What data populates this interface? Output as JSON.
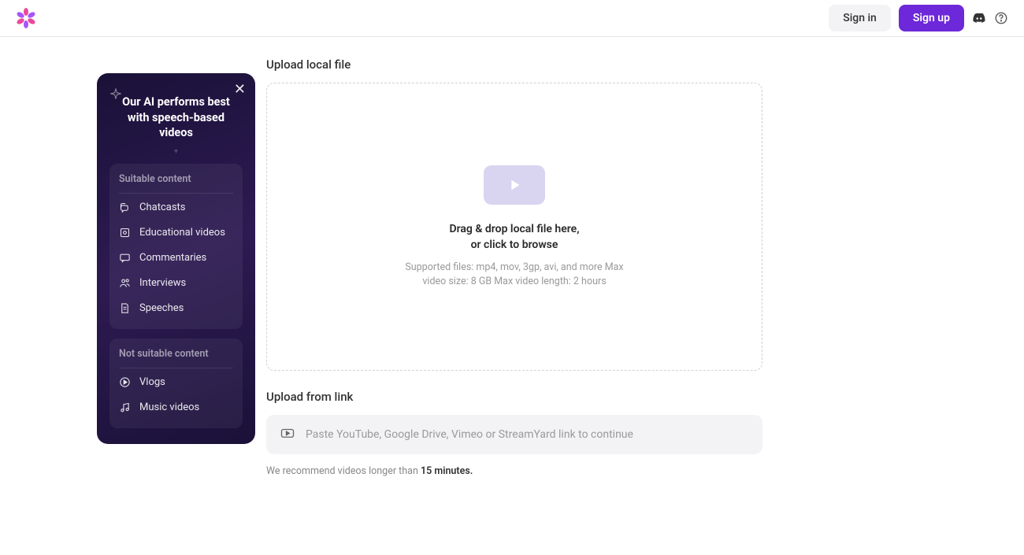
{
  "header": {
    "signin_label": "Sign in",
    "signup_label": "Sign up"
  },
  "info_card": {
    "title": "Our AI performs best with speech-based videos",
    "suitable": {
      "title": "Suitable content",
      "items": [
        {
          "label": "Chatcasts",
          "icon": "chat"
        },
        {
          "label": "Educational videos",
          "icon": "book"
        },
        {
          "label": "Commentaries",
          "icon": "comment"
        },
        {
          "label": "Interviews",
          "icon": "people"
        },
        {
          "label": "Speeches",
          "icon": "doc"
        }
      ]
    },
    "not_suitable": {
      "title": "Not suitable content",
      "items": [
        {
          "label": "Vlogs",
          "icon": "play-circle"
        },
        {
          "label": "Music videos",
          "icon": "music"
        }
      ]
    }
  },
  "upload": {
    "local_title": "Upload local file",
    "drag_line1": "Drag & drop local file here,",
    "drag_line2": "or click to browse",
    "supported": "Supported files: mp4, mov, 3gp, avi, and more Max video size: 8 GB Max video length: 2 hours",
    "link_title": "Upload from link",
    "link_placeholder": "Paste YouTube, Google Drive, Vimeo or StreamYard link to continue",
    "recommend_prefix": "We recommend videos longer than ",
    "recommend_strong": "15 minutes."
  }
}
